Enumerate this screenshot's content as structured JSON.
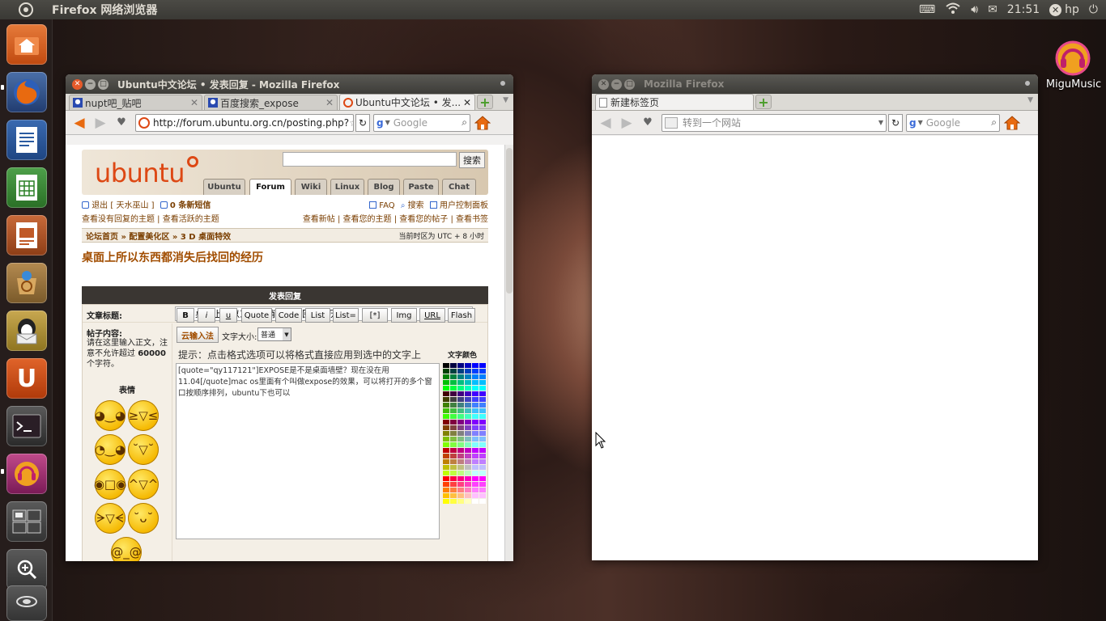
{
  "top_panel": {
    "app_title": "Firefox 网络浏览器",
    "time": "21:51",
    "user": "hp"
  },
  "desktop": {
    "icon_label": "MiguMusic"
  },
  "launcher": {
    "items": [
      "home-folder",
      "firefox",
      "writer",
      "calc",
      "impress",
      "software-center",
      "mail",
      "ubuntu-one",
      "terminal",
      "migumusic",
      "workspace-switcher",
      "lens-search",
      "trash"
    ]
  },
  "window_left": {
    "title": "Ubuntu中文论坛 • 发表回复 - Mozilla Firefox",
    "tabs": [
      {
        "label": "nupt吧_贴吧"
      },
      {
        "label": "百度搜索_expose"
      },
      {
        "label": "Ubuntu中文论坛 • 发..."
      }
    ],
    "url": "http://forum.ubuntu.org.cn/posting.php?",
    "search_placeholder": "Google",
    "page": {
      "logo": "ubuntu",
      "search_button": "搜索",
      "portal_tabs": [
        "Ubuntu",
        "Forum",
        "Wiki",
        "Linux",
        "Blog",
        "Paste",
        "Chat"
      ],
      "user_line_left": "退出 [ 天水巫山 ]",
      "messages": "0 条新短信",
      "user_links_right": [
        "FAQ",
        "搜索",
        "用户控制面板"
      ],
      "links_left": "查看没有回复的主题 | 查看活跃的主题",
      "links_right": "查看新帖 | 查看您的主题 | 查看您的帖子 | 查看书签",
      "breadcrumb": "论坛首页 » 配置美化区 » 3 D 桌面特效",
      "timezone": "当前时区为 UTC + 8 小时",
      "topic_title": "桌面上所以东西都消失后找回的经历",
      "post_header": "发表回复",
      "subject_label": "文章标题:",
      "subject_value": "Re: 桌面上所以东西都消失后找回的经历",
      "body_label": "帖子内容:",
      "body_hint": "请在这里输入正文，注意不允许超过 60000 个字符。",
      "body_hint_pre": "请在这里输入正文，注意不允许超过",
      "body_hint_num": "60000",
      "body_hint_post": "个字符。",
      "emoticons_label": "表情",
      "format_buttons": [
        "B",
        "i",
        "u",
        "Quote",
        "Code",
        "List",
        "List=",
        "[*]",
        "Img",
        "URL",
        "Flash"
      ],
      "cloud_input": "云输入法",
      "font_size_label": "文字大小:",
      "font_size_value": "普通",
      "tip": "提示：点击格式选项可以将格式直接应用到选中的文字上",
      "color_label": "文字颜色",
      "message_text": "[quote=\"qy117121\"]EXPOSE是不是桌面墙壁？现在没在用11.04[/quote]mac os里面有个叫做expose的效果，可以将打开的多个窗口按顺序排列，ubuntu下也可以"
    }
  },
  "window_right": {
    "title": "Mozilla Firefox",
    "tabs": [
      {
        "label": "新建标签页"
      }
    ],
    "url_placeholder": "转到一个网站",
    "search_placeholder": "Google"
  },
  "colors": {
    "panel": "#3c3b37",
    "ubuntu_orange": "#dd4814",
    "forum_dark": "#3a3632",
    "forum_link": "#7a3e00"
  }
}
